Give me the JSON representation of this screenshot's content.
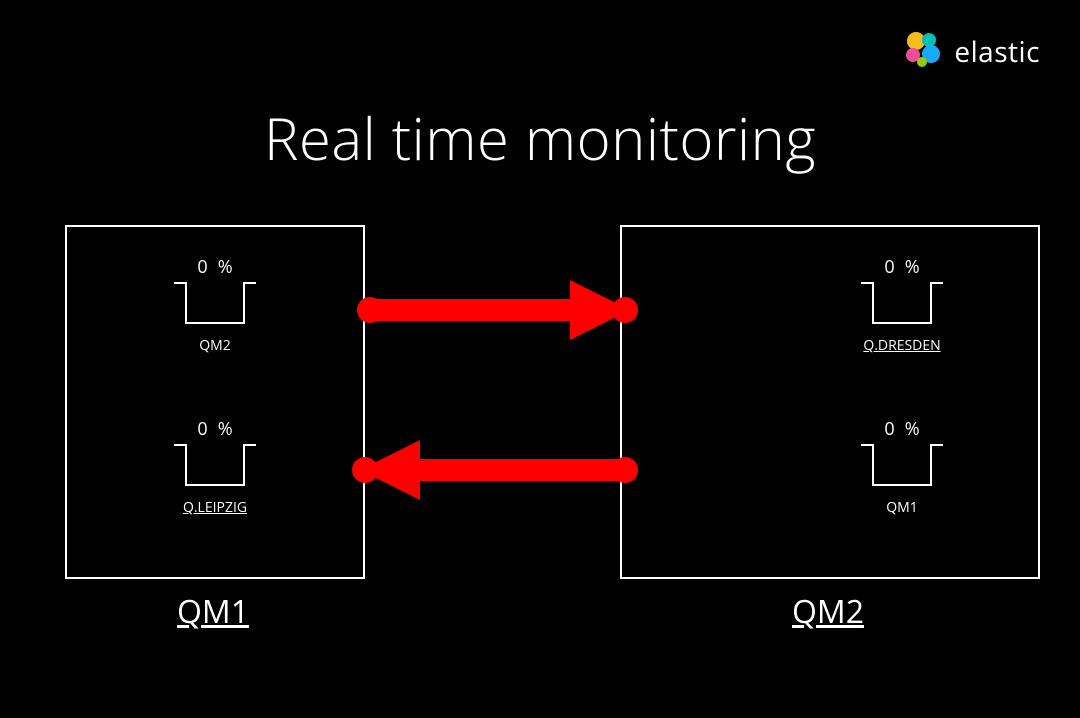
{
  "brand": {
    "name": "elastic"
  },
  "title": "Real time monitoring",
  "colors": {
    "arrow": "#ff0000",
    "fg": "#ffffff",
    "bg": "#000000",
    "logo_yellow": "#f4bd19",
    "logo_teal": "#00bfb3",
    "logo_pink": "#f04e98",
    "logo_blue": "#1ba9f5",
    "logo_green": "#93c90e"
  },
  "qm1": {
    "caption": "QM1",
    "cells": [
      {
        "value": "0",
        "unit": "%",
        "label": "QM2",
        "underline": false
      },
      {
        "value": "0",
        "unit": "%",
        "label": "Q.LEIPZIG",
        "underline": true
      }
    ]
  },
  "qm2": {
    "caption": "QM2",
    "cells": [
      {
        "value": "0",
        "unit": "%",
        "label": "Q.DRESDEN",
        "underline": true
      },
      {
        "value": "0",
        "unit": "%",
        "label": "QM1",
        "underline": false
      }
    ]
  },
  "chart_data": {
    "type": "table",
    "title": "Real time monitoring",
    "series": [
      {
        "name": "QM1",
        "values": [
          {
            "queue": "QM2",
            "percent": 0
          },
          {
            "queue": "Q.LEIPZIG",
            "percent": 0
          }
        ]
      },
      {
        "name": "QM2",
        "values": [
          {
            "queue": "Q.DRESDEN",
            "percent": 0
          },
          {
            "queue": "QM1",
            "percent": 0
          }
        ]
      }
    ],
    "flows": [
      {
        "from": "QM1",
        "to": "QM2"
      },
      {
        "from": "QM2",
        "to": "QM1"
      }
    ],
    "ylim": [
      0,
      100
    ]
  }
}
